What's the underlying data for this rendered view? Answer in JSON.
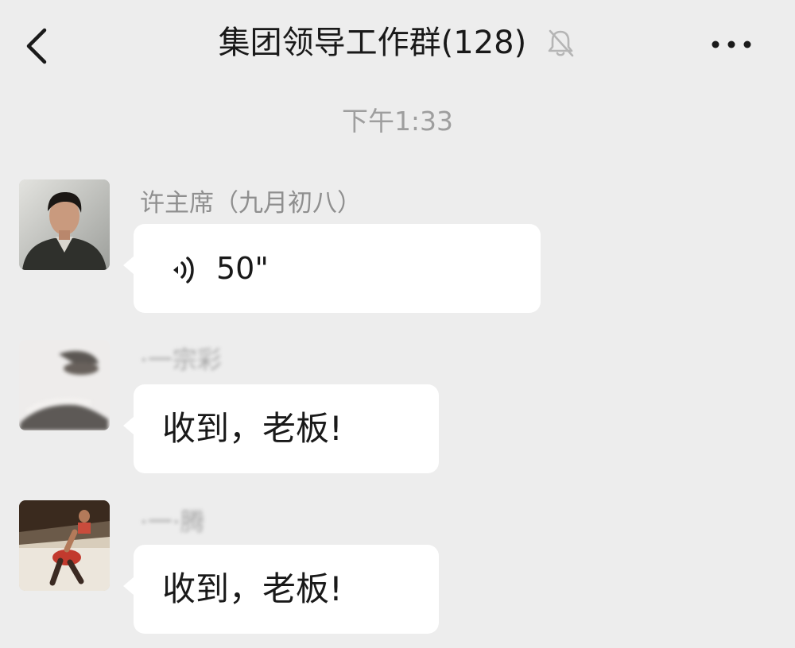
{
  "header": {
    "title": "集团领导工作群(128)",
    "back_icon": "chevron-left-icon",
    "mute_icon": "bell-muted-icon",
    "more_icon": "ellipsis-icon"
  },
  "timestamp": "下午1:33",
  "messages": [
    {
      "sender": "许主席（九月初八）",
      "type": "voice",
      "duration": "50\"",
      "icon": "voice-wave-icon"
    },
    {
      "sender": "·一宗彩",
      "type": "text",
      "text": "收到，老板!"
    },
    {
      "sender": "·一·腾",
      "type": "text",
      "text": "收到，老板!"
    }
  ],
  "colors": {
    "background": "#ededed",
    "bubble": "#ffffff",
    "muted_text": "#9e9e9e"
  }
}
